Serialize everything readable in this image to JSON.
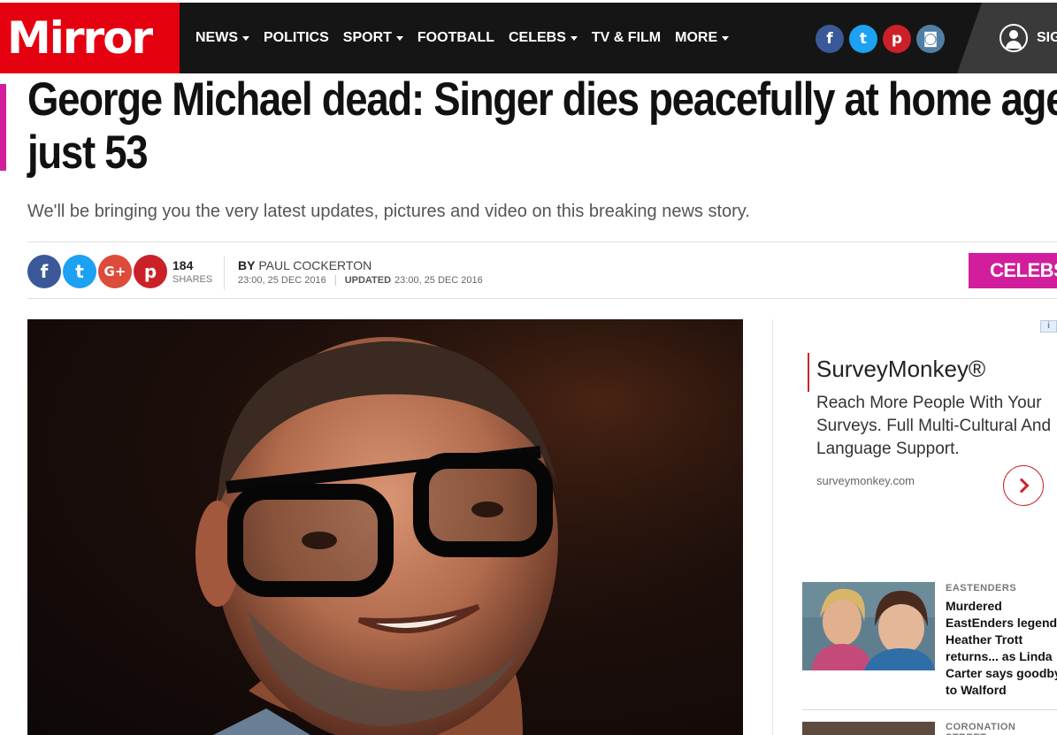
{
  "brand": {
    "logo_text": "Mirror",
    "accent": "#e5000f",
    "celebs_color": "#d21e9c"
  },
  "nav": {
    "items": [
      {
        "label": "NEWS",
        "dropdown": true
      },
      {
        "label": "POLITICS",
        "dropdown": false
      },
      {
        "label": "SPORT",
        "dropdown": true
      },
      {
        "label": "FOOTBALL",
        "dropdown": false
      },
      {
        "label": "CELEBS",
        "dropdown": true
      },
      {
        "label": "TV & FILM",
        "dropdown": false
      },
      {
        "label": "MORE",
        "dropdown": true
      }
    ],
    "social": [
      {
        "icon": "facebook-icon",
        "glyph": "f"
      },
      {
        "icon": "twitter-icon",
        "glyph": "t"
      },
      {
        "icon": "pinterest-icon",
        "glyph": "p"
      },
      {
        "icon": "instagram-icon",
        "glyph": "◙"
      }
    ],
    "signin_label": "SIG"
  },
  "article": {
    "headline_line1": "George Michael dead: Singer dies peacefully at home aged",
    "headline_line2": "just 53",
    "standfirst": "We'll be bringing you the very latest updates, pictures and video on this breaking news story.",
    "share": {
      "buttons": [
        {
          "icon": "facebook-icon",
          "glyph": "f"
        },
        {
          "icon": "twitter-icon",
          "glyph": "t"
        },
        {
          "icon": "google-plus-icon",
          "glyph": "G+"
        },
        {
          "icon": "pinterest-icon",
          "glyph": "p"
        }
      ],
      "count": "184",
      "count_label": "SHARES"
    },
    "byline_prefix": "BY",
    "author": "PAUL COCKERTON",
    "published": "23:00, 25 DEC 2016",
    "updated_label": "UPDATED",
    "updated": "23:00, 25 DEC 2016",
    "section_tag": "CELEBS"
  },
  "ad": {
    "badge": "i",
    "title": "SurveyMonkey®",
    "body": "Reach More People With Your Surveys. Full Multi-Cultural And Language Support.",
    "url": "surveymonkey.com"
  },
  "related": [
    {
      "kicker": "EASTENDERS",
      "title": "Murdered EastEnders legend Heather Trott returns... as Linda Carter says goodbye to Walford"
    },
    {
      "kicker": "CORONATION STREET"
    }
  ]
}
